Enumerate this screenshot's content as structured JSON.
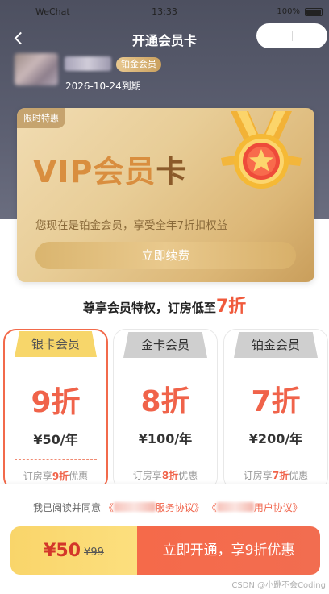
{
  "status_bar": {
    "carrier": "WeChat",
    "time": "13:33",
    "battery": "100%"
  },
  "nav": {
    "title": "开通会员卡"
  },
  "user": {
    "level_badge": "铂金会员",
    "expire": "2026-10-24到期"
  },
  "vip_card": {
    "corner_tag": "限时特惠",
    "title_part1": "VIP会员",
    "title_part2": "卡",
    "description": "您现在是铂金会员，享受全年7折扣权益",
    "renew_label": "立即续费"
  },
  "section": {
    "title_prefix": "尊享会员特权，订房低至",
    "title_highlight": "7折"
  },
  "tiers": [
    {
      "name": "银卡会员",
      "discount": "9折",
      "price": "¥50/年",
      "benefit_prefix": "订房享",
      "benefit_highlight": "9折",
      "benefit_suffix": "优惠",
      "selected": true
    },
    {
      "name": "金卡会员",
      "discount": "8折",
      "price": "¥100/年",
      "benefit_prefix": "订房享",
      "benefit_highlight": "8折",
      "benefit_suffix": "优惠",
      "selected": false
    },
    {
      "name": "铂金会员",
      "discount": "7折",
      "price": "¥200/年",
      "benefit_prefix": "订房享",
      "benefit_highlight": "7折",
      "benefit_suffix": "优惠",
      "selected": false
    }
  ],
  "agreement": {
    "prefix": "我已阅读并同意",
    "link1_suffix": "服务协议》",
    "link2_suffix": "用户协议》",
    "open_bracket": "《"
  },
  "cta": {
    "price_now": "¥50",
    "price_old": "¥99",
    "button_label": "立即开通，享9折优惠"
  },
  "watermark": "CSDN @小跳不会Coding",
  "colors": {
    "accent": "#f0634a",
    "gold": "#dab56f",
    "header_bg": "#4d5060",
    "tab_yellow": "#f7d66a"
  }
}
